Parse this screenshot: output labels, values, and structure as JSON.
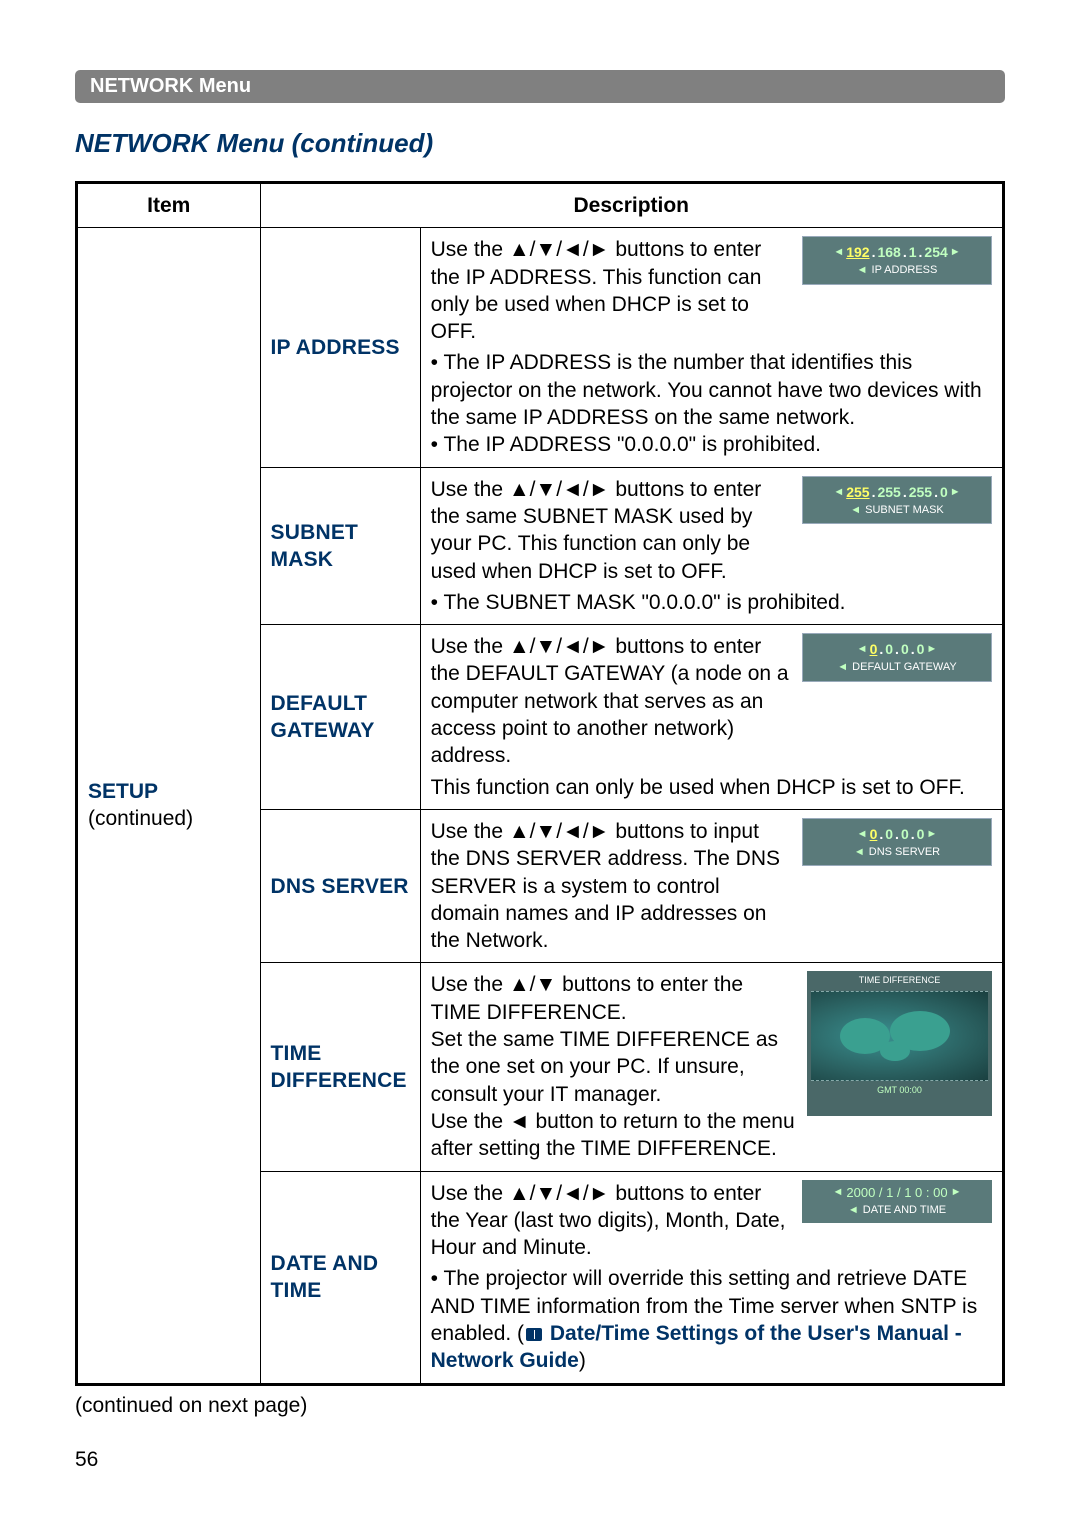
{
  "header_bar": "NETWORK Menu",
  "section_title": "NETWORK Menu (continued)",
  "col_headers": {
    "item": "Item",
    "desc": "Description"
  },
  "main_item": {
    "label": "SETUP",
    "sub": "(continued)"
  },
  "rows": [
    {
      "sub": "IP ADDRESS",
      "desc1": "Use the ▲/▼/◄/► buttons to enter the IP ADDRESS. This function can only be used when DHCP is set to OFF.",
      "desc2": "• The IP ADDRESS is the number that identifies this projector on the network. You cannot have two devices with the same IP ADDRESS on the same network.\n• The IP ADDRESS \"0.0.0.0\" is prohibited.",
      "osd": {
        "octets": [
          "192",
          "168",
          "1",
          "254"
        ],
        "hl": 0,
        "label": "IP ADDRESS"
      }
    },
    {
      "sub": "SUBNET MASK",
      "desc1": "Use the ▲/▼/◄/► buttons to enter the same SUBNET MASK used by your PC. This function can only be used when DHCP is set to OFF.",
      "desc2": "• The SUBNET MASK \"0.0.0.0\" is prohibited.",
      "osd": {
        "octets": [
          "255",
          "255",
          "255",
          "0"
        ],
        "hl": 0,
        "label": "SUBNET MASK"
      }
    },
    {
      "sub": "DEFAULT GATEWAY",
      "desc1": "Use the ▲/▼/◄/► buttons to enter the DEFAULT GATEWAY (a node on a computer network that serves as an access point to another network) address.",
      "desc2": "This function can only be used when DHCP is set to OFF.",
      "osd": {
        "octets": [
          "0",
          "0",
          "0",
          "0"
        ],
        "hl": 0,
        "label": "DEFAULT GATEWAY"
      }
    },
    {
      "sub": "DNS SERVER",
      "desc1": "Use the ▲/▼/◄/► buttons to input the DNS SERVER address. The DNS SERVER is a system to control domain names and IP addresses on the Network.",
      "desc2": "",
      "osd": {
        "octets": [
          "0",
          "0",
          "0",
          "0"
        ],
        "hl": 0,
        "label": "DNS SERVER"
      }
    },
    {
      "sub": "TIME DIFFERENCE",
      "desc1": "Use the ▲/▼ buttons to enter the TIME DIFFERENCE.\nSet the same TIME DIFFERENCE as the one set on your PC. If unsure, consult your IT manager.\nUse the ◄ button to return to the menu after setting the TIME DIFFERENCE.",
      "desc2": "",
      "map": {
        "title": "TIME DIFFERENCE",
        "gmt": "GMT 00:00"
      }
    },
    {
      "sub": "DATE AND TIME",
      "desc1": "Use the ▲/▼/◄/► buttons to enter the Year (last two digits), Month, Date, Hour and Minute.",
      "desc2": "• The projector will override this setting and retrieve DATE AND TIME information from the Time server when SNTP is enabled. (",
      "desc2_bold": " Date/Time Settings of the User's Manual - Network Guide",
      "desc2_end": ")",
      "dt": {
        "line": "2000 /  1  /  1     0 : 00",
        "label": "DATE AND TIME"
      }
    }
  ],
  "continued": "(continued on next page)",
  "page": "56"
}
